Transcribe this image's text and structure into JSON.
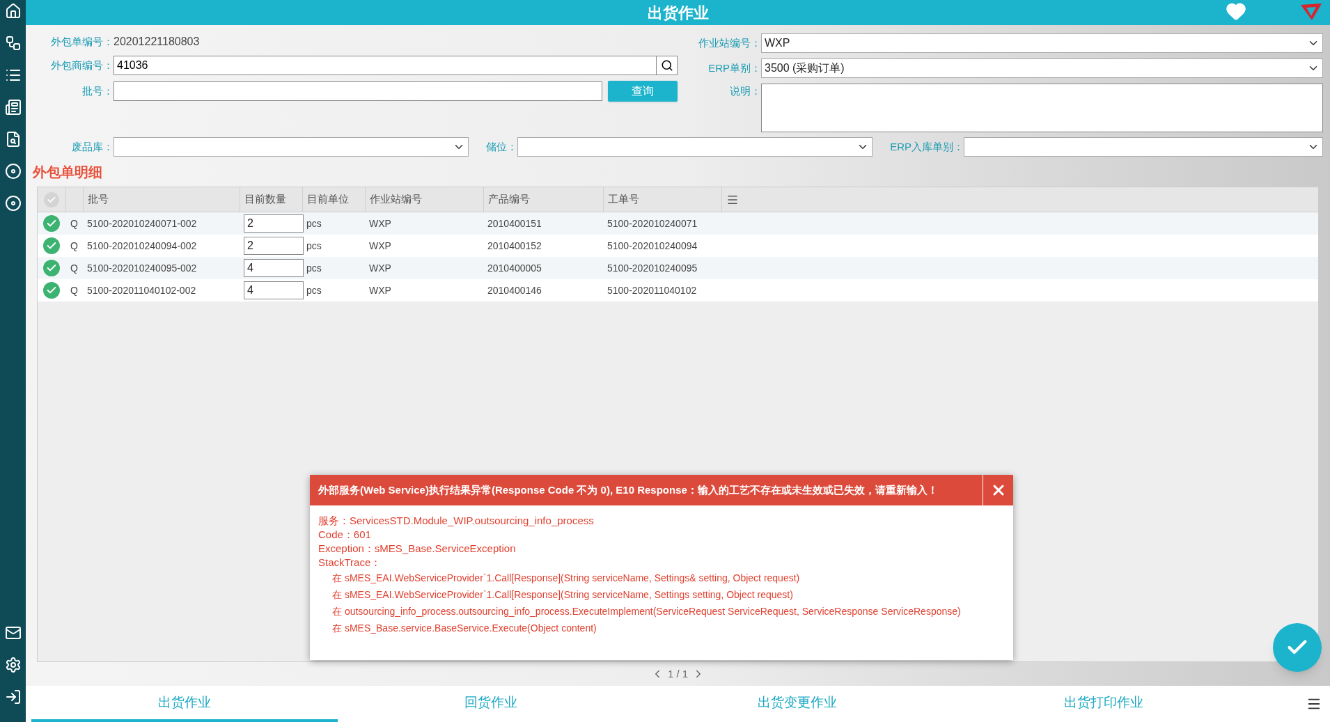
{
  "header": {
    "title": "出货作业"
  },
  "form": {
    "order_no": {
      "label": "外包单编号：",
      "value": "20201221180803"
    },
    "vendor": {
      "label": "外包商编号：",
      "value": "41036"
    },
    "batch": {
      "label": "批号："
    },
    "query_button": "查询",
    "station": {
      "label": "作业站编号：",
      "value": "WXP"
    },
    "erp_type": {
      "label": "ERP单别：",
      "value": "3500 (采购订单)"
    },
    "note": {
      "label": "说明："
    },
    "scrap": {
      "label": "废品库："
    },
    "location": {
      "label": "储位："
    },
    "erp_in": {
      "label": "ERP入库单别："
    }
  },
  "section_title": "外包单明细",
  "table": {
    "all_checked": false,
    "columns": [
      "批号",
      "目前数量",
      "目前单位",
      "作业站编号",
      "产品编号",
      "工单号"
    ],
    "rows": [
      {
        "checked": true,
        "flag": "Q",
        "cells": [
          "5100-202010240071-002",
          "2",
          "pcs",
          "WXP",
          "2010400151",
          "5100-202010240071"
        ]
      },
      {
        "checked": true,
        "flag": "Q",
        "cells": [
          "5100-202010240094-002",
          "2",
          "pcs",
          "WXP",
          "2010400152",
          "5100-202010240094"
        ]
      },
      {
        "checked": true,
        "flag": "Q",
        "cells": [
          "5100-202010240095-002",
          "4",
          "pcs",
          "WXP",
          "2010400005",
          "5100-202010240095"
        ]
      },
      {
        "checked": true,
        "flag": "Q",
        "cells": [
          "5100-202011040102-002",
          "4",
          "pcs",
          "WXP",
          "2010400146",
          "5100-202011040102"
        ]
      }
    ]
  },
  "pager": "1 / 1",
  "dialog": {
    "title": "外部服务(Web Service)执行结果异常(Response Code 不为 0), E10 Response：输入的工艺不存在或未生效或已失效，请重新输入！",
    "lines": [
      "服务：ServicesSTD.Module_WIP.outsourcing_info_process",
      "Code：601",
      "Exception：sMES_Base.ServiceException",
      "StackTrace："
    ],
    "stack": [
      "在 sMES_EAI.WebServiceProvider`1.Call[Response](String serviceName, Settings& setting, Object request)",
      "在 sMES_EAI.WebServiceProvider`1.Call[Response](String serviceName, Settings setting, Object request)",
      "在 outsourcing_info_process.outsourcing_info_process.ExecuteImplement(ServiceRequest ServiceRequest, ServiceResponse ServiceResponse)",
      "在 sMES_Base.service.BaseService.Execute(Object content)"
    ]
  },
  "tabs": [
    {
      "label": "出货作业",
      "selected": true
    },
    {
      "label": "回货作业",
      "selected": false
    },
    {
      "label": "出货变更作业",
      "selected": false
    },
    {
      "label": "出货打印作业",
      "selected": false
    }
  ]
}
